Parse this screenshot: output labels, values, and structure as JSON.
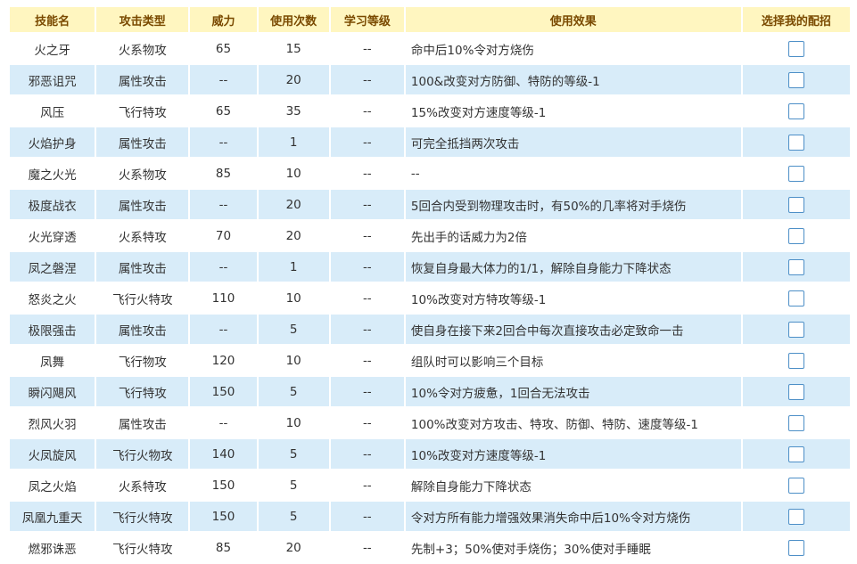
{
  "headers": [
    "技能名",
    "攻击类型",
    "威力",
    "使用次数",
    "学习等级",
    "使用效果",
    "选择我的配招"
  ],
  "rows": [
    {
      "name": "火之牙",
      "type": "火系物攻",
      "power": "65",
      "uses": "15",
      "level": "--",
      "effect": "命中后10%令对方烧伤"
    },
    {
      "name": "邪恶诅咒",
      "type": "属性攻击",
      "power": "--",
      "uses": "20",
      "level": "--",
      "effect": "100&改变对方防御、特防的等级-1"
    },
    {
      "name": "风压",
      "type": "飞行特攻",
      "power": "65",
      "uses": "35",
      "level": "--",
      "effect": "15%改变对方速度等级-1"
    },
    {
      "name": "火焰护身",
      "type": "属性攻击",
      "power": "--",
      "uses": "1",
      "level": "--",
      "effect": "可完全抵挡两次攻击"
    },
    {
      "name": "魔之火光",
      "type": "火系物攻",
      "power": "85",
      "uses": "10",
      "level": "--",
      "effect": "--"
    },
    {
      "name": "极度战衣",
      "type": "属性攻击",
      "power": "--",
      "uses": "20",
      "level": "--",
      "effect": "5回合内受到物理攻击时，有50%的几率将对手烧伤"
    },
    {
      "name": "火光穿透",
      "type": "火系特攻",
      "power": "70",
      "uses": "20",
      "level": "--",
      "effect": "先出手的话威力为2倍"
    },
    {
      "name": "凤之磐涅",
      "type": "属性攻击",
      "power": "--",
      "uses": "1",
      "level": "--",
      "effect": "恢复自身最大体力的1/1，解除自身能力下降状态"
    },
    {
      "name": "怒炎之火",
      "type": "飞行火特攻",
      "power": "110",
      "uses": "10",
      "level": "--",
      "effect": "10%改变对方特攻等级-1"
    },
    {
      "name": "极限强击",
      "type": "属性攻击",
      "power": "--",
      "uses": "5",
      "level": "--",
      "effect": "使自身在接下来2回合中每次直接攻击必定致命一击"
    },
    {
      "name": "凤舞",
      "type": "飞行物攻",
      "power": "120",
      "uses": "10",
      "level": "--",
      "effect": "组队时可以影响三个目标"
    },
    {
      "name": "瞬闪飓风",
      "type": "飞行特攻",
      "power": "150",
      "uses": "5",
      "level": "--",
      "effect": "10%令对方疲惫，1回合无法攻击"
    },
    {
      "name": "烈风火羽",
      "type": "属性攻击",
      "power": "--",
      "uses": "10",
      "level": "--",
      "effect": "100%改变对方攻击、特攻、防御、特防、速度等级-1"
    },
    {
      "name": "火凤旋风",
      "type": "飞行火物攻",
      "power": "140",
      "uses": "5",
      "level": "--",
      "effect": "10%改变对方速度等级-1"
    },
    {
      "name": "凤之火焰",
      "type": "火系特攻",
      "power": "150",
      "uses": "5",
      "level": "--",
      "effect": "解除自身能力下降状态"
    },
    {
      "name": "凤凰九重天",
      "type": "飞行火特攻",
      "power": "150",
      "uses": "5",
      "level": "--",
      "effect": "令对方所有能力增强效果消失命中后10%令对方烧伤"
    },
    {
      "name": "燃邪诛恶",
      "type": "飞行火特攻",
      "power": "85",
      "uses": "20",
      "level": "--",
      "effect": "先制+3；50%使对手烧伤；30%使对手睡眠"
    }
  ]
}
